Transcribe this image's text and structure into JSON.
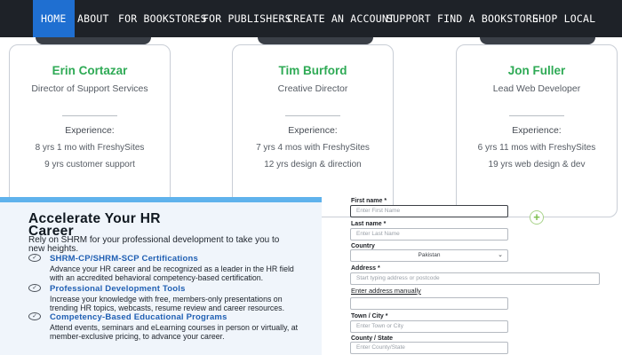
{
  "nav": {
    "items": [
      {
        "label": "HOME",
        "active": true
      },
      {
        "label": "ABOUT"
      },
      {
        "label": "FOR BOOKSTORES"
      },
      {
        "label": "FOR PUBLISHERS"
      },
      {
        "label": "CREATE AN ACCOUNT"
      },
      {
        "label": "SUPPORT"
      },
      {
        "label": "FIND A BOOKSTORE"
      },
      {
        "label": "SHOP LOCAL"
      }
    ],
    "active_color": "#1f6fd1",
    "background": "#1e2228"
  },
  "team": {
    "accent_color": "#2eaa55",
    "members": [
      {
        "name": "Erin Cortazar",
        "title": "Director of Support Services",
        "experience_label": "Experience:",
        "lines": [
          "8 yrs 1 mo with FreshySites",
          "9 yrs customer support"
        ],
        "expand_icon": "plus-icon"
      },
      {
        "name": "Tim Burford",
        "title": "Creative Director",
        "experience_label": "Experience:",
        "lines": [
          "7 yrs 4 mos with FreshySites",
          "12 yrs design & direction"
        ],
        "expand_icon": "plus-icon"
      },
      {
        "name": "Jon Fuller",
        "title": "Lead Web Developer",
        "experience_label": "Experience:",
        "lines": [
          "6 yrs 11 mos with FreshySites",
          "19 yrs web design & dev"
        ],
        "expand_icon": "plus-icon"
      }
    ]
  },
  "promo": {
    "headline_line1": "Accelerate Your HR",
    "headline_line2": "Career",
    "intro": "Rely on SHRM for your professional development to take you to new heights.",
    "link_color": "#1f5fb3",
    "items": [
      {
        "title": "SHRM-CP/SHRM-SCP Certifications",
        "desc": "Advance your HR career and be recognized as a leader in the HR field with an accredited behavioral competency-based certification.",
        "icon": "check-circle-icon"
      },
      {
        "title": "Professional Development Tools",
        "desc": "Increase your knowledge with free, members-only presentations on trending HR topics, webcasts, resume review and career resources.",
        "icon": "check-circle-icon"
      },
      {
        "title": "Competency-Based Educational Programs",
        "desc": "Attend events, seminars and eLearning courses in person or virtually, at member-exclusive pricing, to advance your career.",
        "icon": "check-circle-icon"
      }
    ]
  },
  "form": {
    "first_name": {
      "label": "First name *",
      "placeholder": "Enter First Name"
    },
    "last_name": {
      "label": "Last name *",
      "placeholder": "Enter Last Name"
    },
    "country": {
      "label": "Country",
      "value": "Pakistan",
      "icon": "chevron-down-icon"
    },
    "address": {
      "label": "Address *",
      "placeholder": "Start typing address or postcode"
    },
    "manual_link": "Enter address manually",
    "town": {
      "label": "Town / City *",
      "placeholder": "Enter Town or City"
    },
    "county": {
      "label": "County / State",
      "placeholder": "Enter County/State"
    }
  }
}
